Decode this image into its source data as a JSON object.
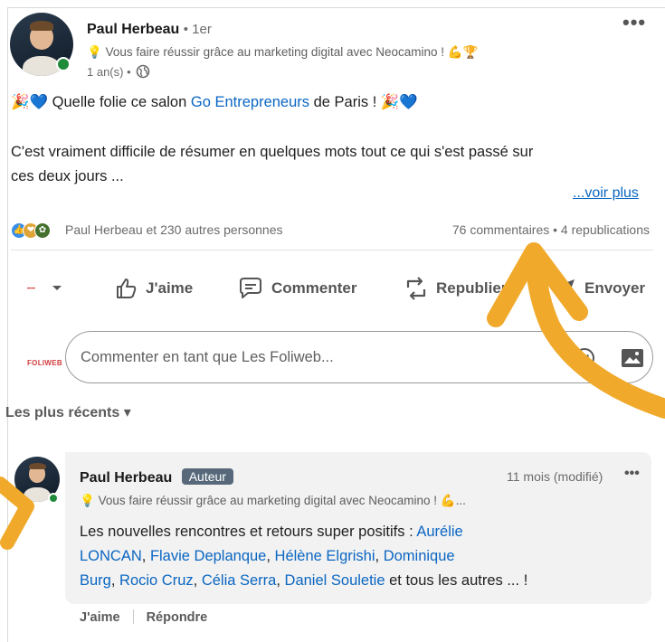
{
  "post": {
    "author_name": "Paul Herbeau",
    "degree": "• 1er",
    "headline": "Vous faire réussir grâce au marketing digital avec Neocamino ! 💪🏆",
    "time": "1 an(s) •",
    "line1_prefix": "🎉💙 Quelle folie ce salon ",
    "line1_link": "Go Entrepreneurs",
    "line1_suffix": " de Paris ! 🎉💙",
    "line2": "C'est vraiment difficile de résumer en quelques mots tout ce qui s'est passé sur",
    "line3": "ces deux jours ...",
    "see_more": "...voir plus",
    "reactions_text": "Paul Herbeau et 230 autres personnes",
    "counts_text": "76 commentaires • 4 republications",
    "more_label": "•••"
  },
  "actions": {
    "like": "J'aime",
    "comment": "Commenter",
    "repost": "Republier",
    "send": "Envoyer"
  },
  "commenter": {
    "brand": "FOLIWEB",
    "placeholder": "Commenter en tant que Les Foliweb..."
  },
  "sort_label": "Les plus récents ▾",
  "comment": {
    "author_name": "Paul Herbeau",
    "badge": "Auteur",
    "time": "11 mois (modifié)",
    "more_label": "•••",
    "headline": "Vous faire réussir grâce au marketing digital avec Neocamino ! 💪...",
    "line1_prefix": "Les nouvelles rencontres et retours super positifs : ",
    "mention1": "Aurélie",
    "mention1b": "LONCAN",
    "mention2": "Flavie Deplanque",
    "mention3": "Hélène Elgrishi",
    "mention4": "Dominique",
    "mention4b": "Burg",
    "mention5": "Rocio Cruz",
    "mention6": "Célia Serra",
    "mention7": "Daniel Souletie",
    "line3_suffix": " et tous les autres ... !",
    "like": "J'aime",
    "reply": "Répondre"
  },
  "colors": {
    "link": "#0a66c2",
    "annotation_arrow": "#f0a92a",
    "badge": "#56687a"
  }
}
